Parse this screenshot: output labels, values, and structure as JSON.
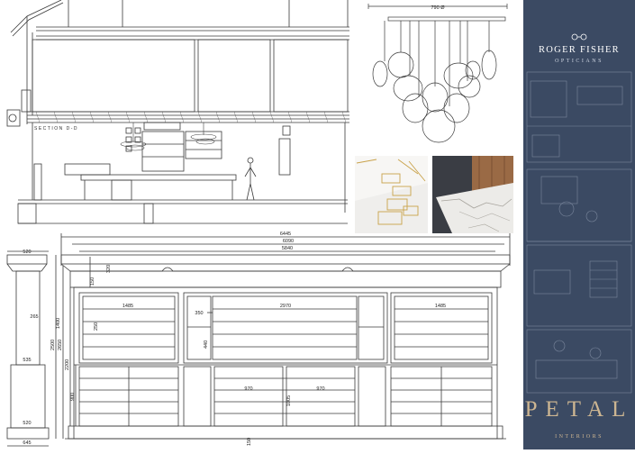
{
  "section_view": {
    "label": "SECTION D-D"
  },
  "pendant": {
    "dimension": "790 Ø"
  },
  "elevation": {
    "dims": {
      "overall_1": "6445",
      "overall_2": "6090",
      "overall_3": "5840",
      "bay_left": "1485",
      "bay_center": "2970",
      "bay_right": "1485",
      "side_350": "350",
      "side_520_top": "520",
      "side_520_bottom": "520",
      "side_265": "265",
      "side_535": "535",
      "side_645": "645",
      "drawer_970_left": "970",
      "drawer_970_right": "970",
      "height_150": "150",
      "height_320": "320",
      "height_2500": "2500",
      "height_2650": "2650",
      "height_2200": "2200",
      "height_900": "900",
      "height_1400": "1400",
      "height_250": "250",
      "height_440": "440",
      "height_1005": "1005",
      "height_150_bottom": "150"
    }
  },
  "brand": {
    "name": "ROGER FISHER",
    "subtitle": "OPTICIANS",
    "logo": "PETAL",
    "logo_sub": "INTERIORS",
    "glasses_icon": "glasses-icon",
    "colors": {
      "panel": "#3b4a63",
      "gold": "#cdb692"
    }
  }
}
